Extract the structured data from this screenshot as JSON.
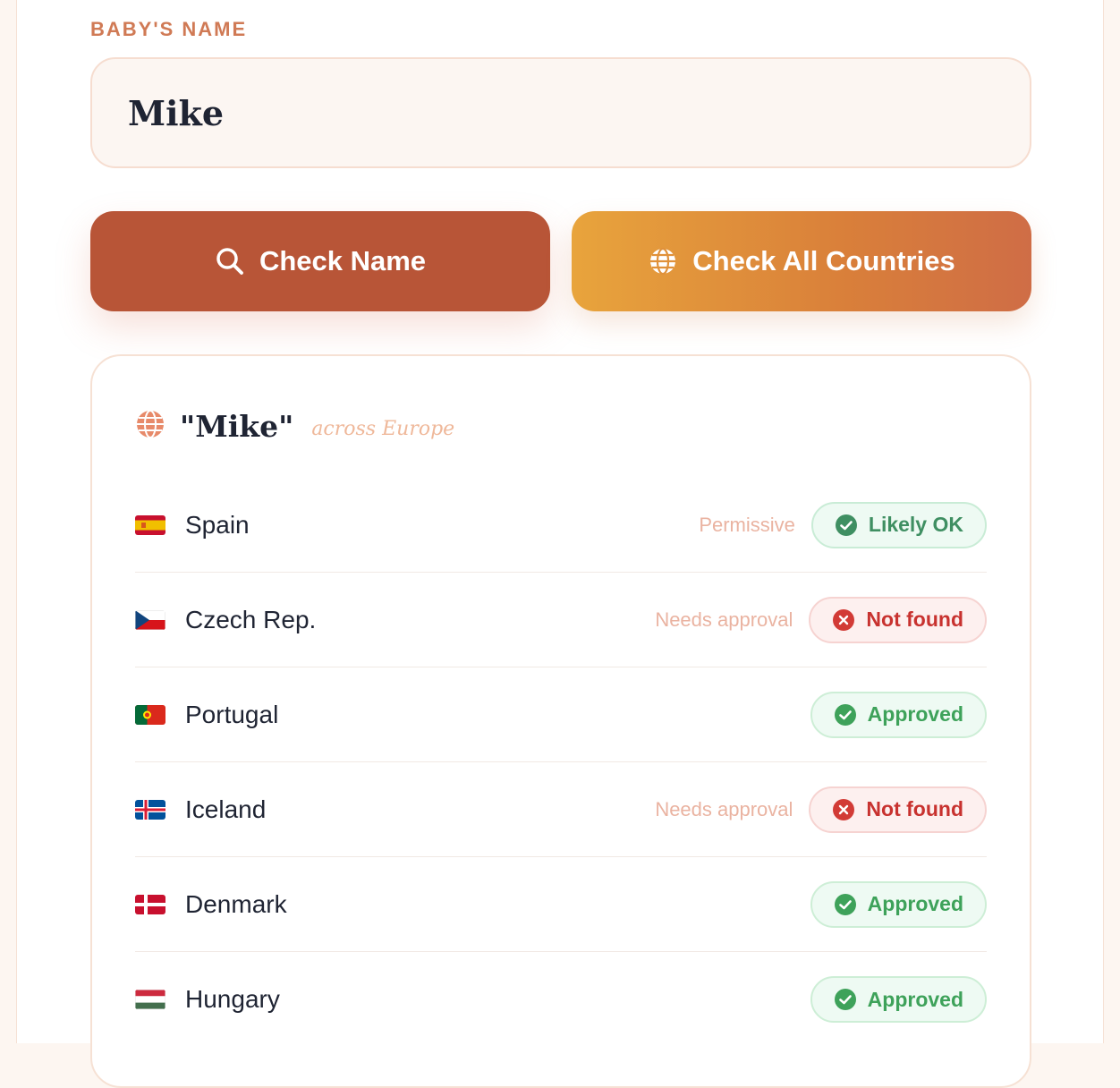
{
  "form": {
    "label": "BABY'S NAME",
    "name_value": "Mike",
    "check_button": "Check Name",
    "check_all_button": "Check All Countries"
  },
  "results": {
    "title": "\"Mike\"",
    "subtitle": "across Europe",
    "rows": [
      {
        "country": "Spain",
        "note": "Permissive",
        "status": "Likely OK",
        "status_type": "ok"
      },
      {
        "country": "Czech Rep.",
        "note": "Needs approval",
        "status": "Not found",
        "status_type": "notfound"
      },
      {
        "country": "Portugal",
        "note": "",
        "status": "Approved",
        "status_type": "approved"
      },
      {
        "country": "Iceland",
        "note": "Needs approval",
        "status": "Not found",
        "status_type": "notfound"
      },
      {
        "country": "Denmark",
        "note": "",
        "status": "Approved",
        "status_type": "approved"
      },
      {
        "country": "Hungary",
        "note": "",
        "status": "Approved",
        "status_type": "approved"
      }
    ]
  },
  "colors": {
    "primary": "#b85537",
    "accent_label": "#d07a55",
    "approved": "#3ea25a",
    "not_found": "#c8322f"
  },
  "icons": {
    "check_button": "search-icon",
    "check_all_button": "globe-icon",
    "results_header": "globe-icon",
    "ok": "check-circle-icon",
    "notfound": "x-circle-icon"
  }
}
